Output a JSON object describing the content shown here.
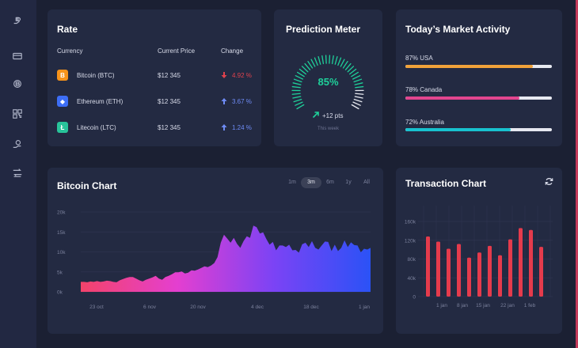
{
  "colors": {
    "background": "#1b2033",
    "card": "#232a42",
    "accent_bar": "#c33a5a",
    "down": "#e0424d",
    "up": "#6f8cf6",
    "gauge": "#1fd09a",
    "bar": "#e53b4c"
  },
  "sidebar": {
    "items": [
      {
        "icon": "bitcoin-hand-icon"
      },
      {
        "icon": "card-icon"
      },
      {
        "icon": "bitcoin-settings-icon"
      },
      {
        "icon": "qr-icon"
      },
      {
        "icon": "coin-hand-icon"
      },
      {
        "icon": "exchange-icon"
      }
    ]
  },
  "rate": {
    "title": "Rate",
    "headers": {
      "currency": "Currency",
      "price": "Current Price",
      "change": "Change"
    },
    "rows": [
      {
        "name": "Bitcoin (BTC)",
        "price": "$12 345",
        "change": "4.92 %",
        "direction": "down",
        "icon": "bitcoin-icon",
        "color": "#f7931a",
        "glyph": "B"
      },
      {
        "name": "Ethereum (ETH)",
        "price": "$12 345",
        "change": "3.67 %",
        "direction": "up",
        "icon": "ethereum-icon",
        "color": "#3d6ef6",
        "glyph": "◆"
      },
      {
        "name": "Litecoin (LTC)",
        "price": "$12 345",
        "change": "1.24 %",
        "direction": "up",
        "icon": "litecoin-icon",
        "color": "#28c39a",
        "glyph": "Ł"
      }
    ]
  },
  "prediction": {
    "title": "Prediction Meter",
    "value": "85%",
    "level": 0.85,
    "delta": "+12 pts",
    "period": "This week"
  },
  "market": {
    "title": "Today’s Market Activity",
    "items": [
      {
        "label": "87% USA",
        "fill": 0.87,
        "color": "#f0a23a"
      },
      {
        "label": "78% Canada",
        "fill": 0.78,
        "color": "#e2458f"
      },
      {
        "label": "72% Australia",
        "fill": 0.72,
        "color": "#18c2cf"
      }
    ]
  },
  "bitcoin_chart": {
    "title": "Bitcoin Chart",
    "ranges": [
      "1m",
      "3m",
      "6m",
      "1y",
      "All"
    ],
    "active_range": "3m"
  },
  "transaction_chart": {
    "title": "Transaction Chart",
    "refresh_icon": "refresh-icon"
  },
  "chart_data": [
    {
      "type": "area",
      "title": "Bitcoin Chart",
      "y_ticks": [
        "20k",
        "15k",
        "10k",
        "5k",
        "0k"
      ],
      "x_ticks": [
        "23 oct",
        "6 nov",
        "20 nov",
        "4 dec",
        "18 dec",
        "1 jan"
      ],
      "ylim": [
        0,
        20000
      ],
      "grid": true,
      "gradient": [
        "#f3436a",
        "#e43fd0",
        "#7b43f5",
        "#2b52f6"
      ],
      "x": [
        0,
        1,
        2,
        3,
        4,
        5,
        6,
        7,
        8,
        9,
        10,
        11,
        12,
        13,
        14,
        15,
        16,
        17,
        18,
        19,
        20,
        21,
        22,
        23,
        24,
        25,
        26,
        27,
        28,
        29,
        30,
        31,
        32,
        33,
        34,
        35,
        36,
        37,
        38,
        39,
        40,
        41,
        42,
        43,
        44,
        45,
        46,
        47,
        48,
        49,
        50,
        51,
        52,
        53,
        54,
        55,
        56,
        57,
        58,
        59,
        60,
        61,
        62,
        63,
        64,
        65,
        66,
        67,
        68,
        69,
        70,
        71,
        72,
        73,
        74,
        75,
        76,
        77,
        78,
        79,
        80,
        81,
        82,
        83,
        84,
        85,
        86,
        87,
        88,
        89
      ],
      "values": [
        2500,
        2500,
        2400,
        2600,
        2500,
        2700,
        2500,
        2600,
        2800,
        2700,
        2500,
        2400,
        2900,
        3200,
        3500,
        3700,
        3700,
        3300,
        2900,
        2600,
        3000,
        3300,
        3600,
        4000,
        3300,
        3000,
        3700,
        4000,
        4400,
        4900,
        4900,
        5100,
        4600,
        4800,
        5400,
        5300,
        5600,
        6000,
        6400,
        6200,
        6600,
        7200,
        8700,
        12300,
        14300,
        13300,
        12300,
        13500,
        12000,
        11000,
        12700,
        13900,
        13500,
        16600,
        16200,
        14600,
        14900,
        13200,
        11800,
        12500,
        10400,
        11600,
        11600,
        11200,
        11800,
        10400,
        10500,
        9800,
        11900,
        12300,
        11200,
        12700,
        11000,
        10600,
        11600,
        12600,
        12500,
        10200,
        11800,
        10200,
        11000,
        12900,
        11200,
        12400,
        11700,
        11600,
        9900,
        10800,
        10600,
        11000
      ]
    },
    {
      "type": "bar",
      "title": "Transaction Chart",
      "y_ticks": [
        "160k",
        "120k",
        "80k",
        "40k",
        "0"
      ],
      "x_ticks": [
        "1 jan",
        "8 jan",
        "15 jan",
        "22 jan",
        "1 feb"
      ],
      "ylim": [
        0,
        160000
      ],
      "grid": true,
      "values": [
        128000,
        117000,
        102000,
        112000,
        83000,
        94000,
        108000,
        88000,
        122000,
        146000,
        142000,
        106000
      ]
    }
  ]
}
